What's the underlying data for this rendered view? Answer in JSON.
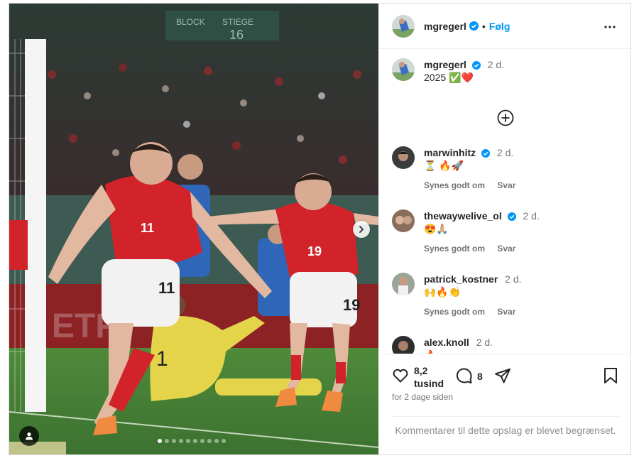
{
  "post": {
    "author": "mgregerl",
    "separator": "•",
    "follow_label": "Følg",
    "more_icon": "more-horizontal-icon"
  },
  "caption": {
    "user": "mgregerl",
    "time": "2 d.",
    "text": "2025 ✅❤️"
  },
  "comments": [
    {
      "user": "marwinhitz",
      "verified": true,
      "time": "2 d.",
      "text": "⏳ 🔥🚀",
      "like_label": "Synes godt om",
      "reply_label": "Svar"
    },
    {
      "user": "thewaywelive_ol",
      "verified": true,
      "time": "2 d.",
      "text": "😍🙏🏼",
      "like_label": "Synes godt om",
      "reply_label": "Svar"
    },
    {
      "user": "patrick_kostner",
      "verified": false,
      "time": "2 d.",
      "text": "🙌🔥👏",
      "like_label": "Synes godt om",
      "reply_label": "Svar"
    },
    {
      "user": "alex.knoll",
      "verified": false,
      "time": "2 d.",
      "text": "🔥"
    }
  ],
  "stats": {
    "likes_line1": "8,2",
    "likes_line2": "tusind",
    "comment_count": "8",
    "age": "for 2 dage siden"
  },
  "restricted_text": "Kommentarer til dette opslag er blevet begrænset.",
  "carousel": {
    "total_dots": 10,
    "active_index": 0
  },
  "colors": {
    "verified": "#0095f6",
    "link": "#0095f6",
    "jersey_red": "#d2232a"
  }
}
